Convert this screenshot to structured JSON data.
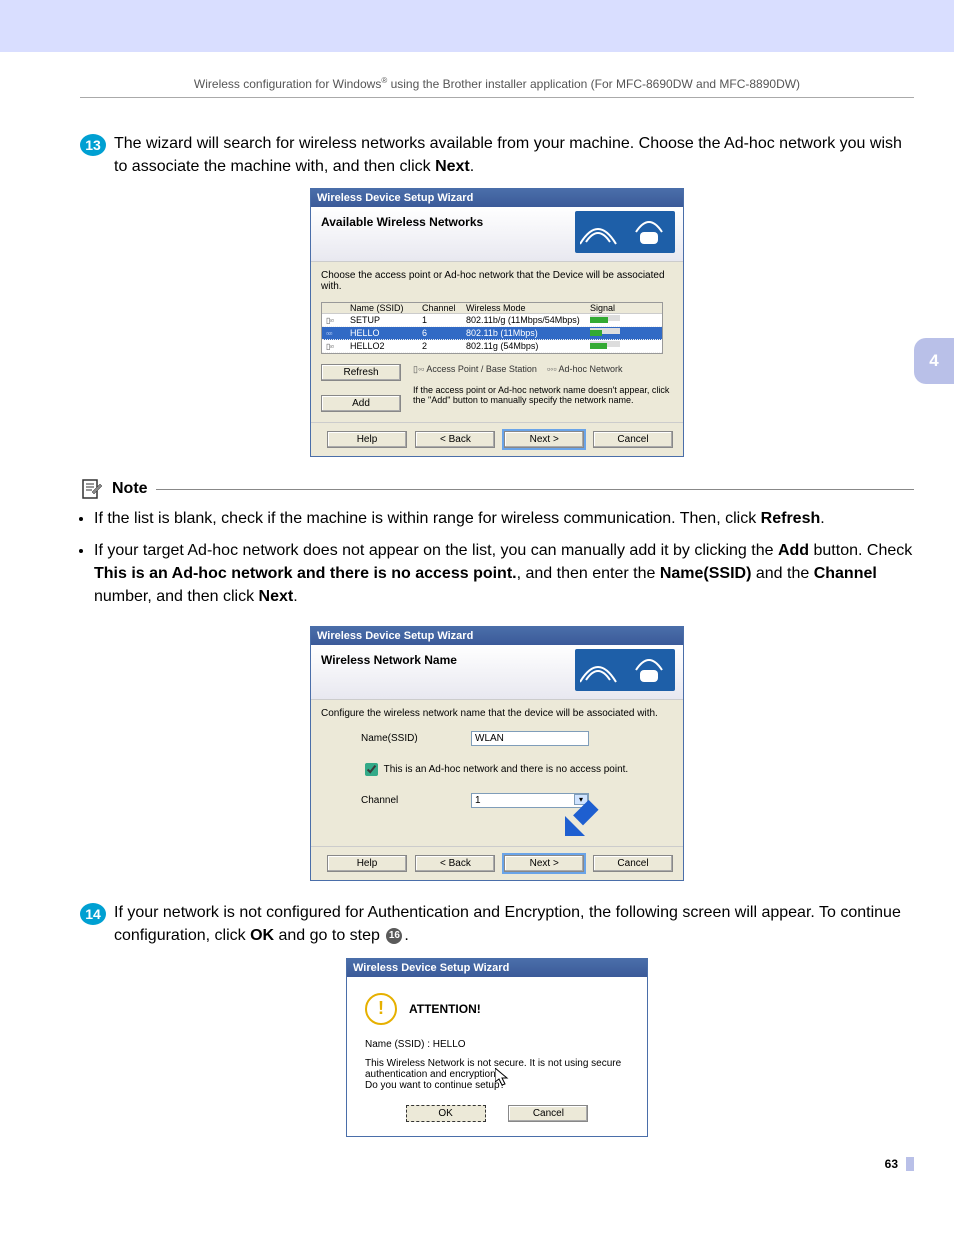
{
  "header": {
    "text_before": "Wireless configuration for Windows",
    "sup": "®",
    "text_after": " using the Brother installer application (For MFC-8690DW and MFC-8890DW)"
  },
  "side_tab": "4",
  "step13": {
    "num": "13",
    "text_a": "The wizard will search for wireless networks available from your machine. Choose the Ad-hoc network you wish to associate the machine with, and then click ",
    "bold": "Next",
    "text_b": "."
  },
  "dialog1": {
    "title": "Wireless Device Setup Wizard",
    "heading": "Available Wireless Networks",
    "instruction": "Choose the access point or Ad-hoc network that the Device will be associated with.",
    "columns": {
      "ssid": "Name (SSID)",
      "channel": "Channel",
      "mode": "Wireless Mode",
      "signal": "Signal"
    },
    "rows": [
      {
        "ssid": "SETUP",
        "channel": "1",
        "mode": "802.11b/g (11Mbps/54Mbps)",
        "signal_pct": 60,
        "selected": false
      },
      {
        "ssid": "HELLO",
        "channel": "6",
        "mode": "802.11b (11Mbps)",
        "signal_pct": 40,
        "selected": true
      },
      {
        "ssid": "HELLO2",
        "channel": "2",
        "mode": "802.11g (54Mbps)",
        "signal_pct": 55,
        "selected": false
      }
    ],
    "refresh": "Refresh",
    "add": "Add",
    "legend_ap": "Access Point / Base Station",
    "legend_adhoc": "Ad-hoc Network",
    "add_hint": "If the access point or Ad-hoc network name doesn't appear, click the \"Add\" button to manually specify the network name.",
    "help": "Help",
    "back": "< Back",
    "next": "Next >",
    "cancel": "Cancel"
  },
  "note": {
    "label": "Note",
    "item1_a": "If the list is blank, check if the machine is within range for wireless communication. Then, click ",
    "item1_bold": "Refresh",
    "item1_b": ".",
    "item2_a": "If your target Ad-hoc network does not appear on the list, you can manually add it by clicking the ",
    "item2_bold_add": "Add",
    "item2_b": " button. Check ",
    "item2_bold_chk": "This is an Ad-hoc network and there is no access point.",
    "item2_c": ", and then enter the ",
    "item2_bold_name": "Name(SSID)",
    "item2_d": " and the ",
    "item2_bold_ch": "Channel",
    "item2_e": " number, and then click ",
    "item2_bold_next": "Next",
    "item2_f": "."
  },
  "dialog2": {
    "title": "Wireless Device Setup Wizard",
    "heading": "Wireless Network Name",
    "instruction": "Configure the wireless network name that the device will be associated with.",
    "name_label": "Name(SSID)",
    "name_value": "WLAN",
    "checkbox_label": "This is an Ad-hoc network and there is no access point.",
    "channel_label": "Channel",
    "channel_value": "1",
    "help": "Help",
    "back": "< Back",
    "next": "Next >",
    "cancel": "Cancel"
  },
  "step14": {
    "num": "14",
    "text_a": "If your network is not configured for Authentication and Encryption, the following screen will appear. To continue configuration, click ",
    "bold_ok": "OK",
    "text_b": " and go to step ",
    "ref": "16",
    "text_c": "."
  },
  "dialog3": {
    "title": "Wireless Device Setup Wizard",
    "attention": "ATTENTION!",
    "ssid_line": "Name (SSID) : HELLO",
    "body1": "This Wireless Network is not secure. It is not using secure authentication and encryption.",
    "body2": "Do you want to continue setup?",
    "ok": "OK",
    "cancel": "Cancel"
  },
  "page_number": "63"
}
